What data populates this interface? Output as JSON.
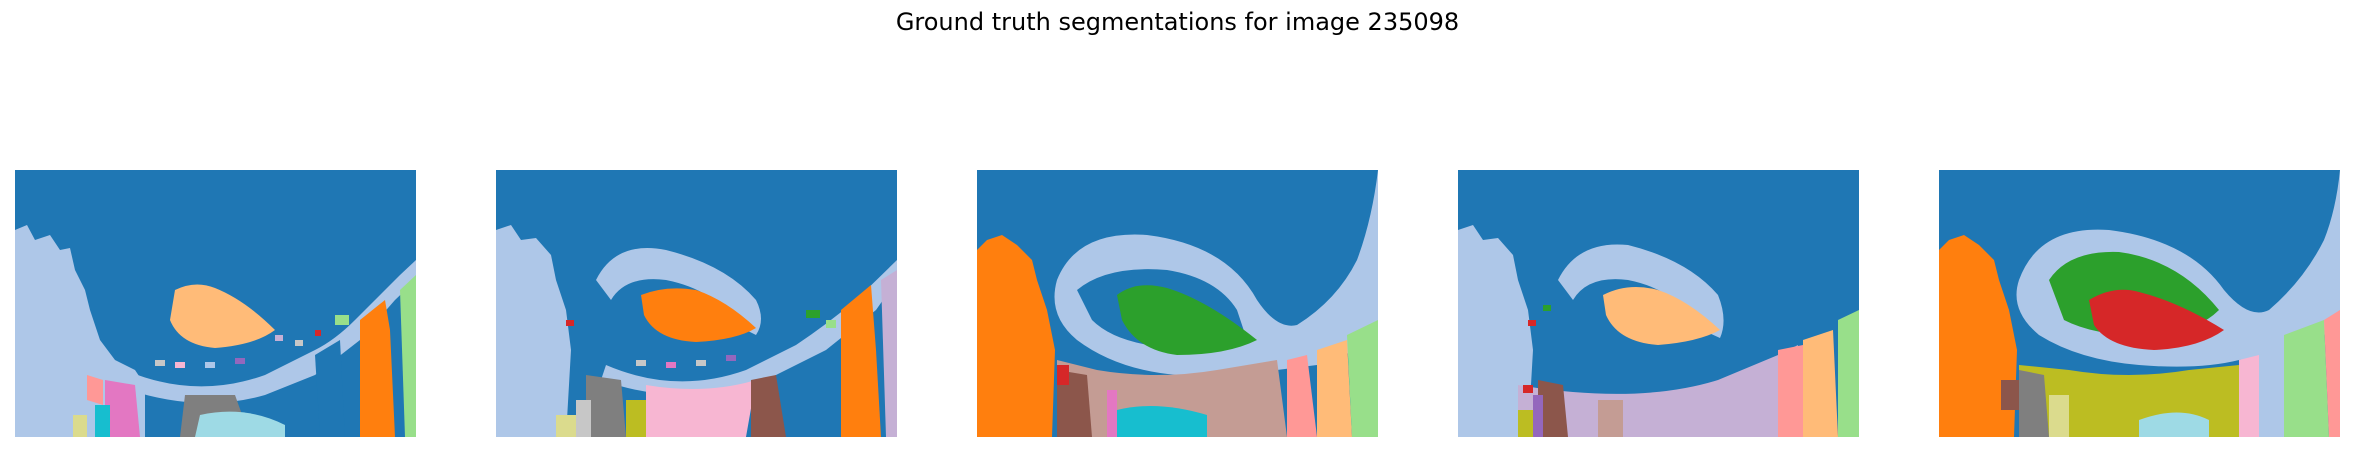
{
  "figure": {
    "title": "Ground truth segmentations for image 235098"
  },
  "panels": [
    {
      "name": "segmentation-1",
      "axis": "off"
    },
    {
      "name": "segmentation-2",
      "axis": "off"
    },
    {
      "name": "segmentation-3",
      "axis": "off"
    },
    {
      "name": "segmentation-4",
      "axis": "off"
    },
    {
      "name": "segmentation-5",
      "axis": "off"
    }
  ],
  "colors": {
    "blue": "#1f77b4",
    "light_blue": "#aec7e8",
    "orange": "#ff7f0e",
    "light_orange": "#ffbb78",
    "green": "#2ca02c",
    "light_green": "#98df8a",
    "red": "#d62728",
    "pink": "#e377c2",
    "light_pink": "#f7b6d2",
    "brown": "#8c564b",
    "rose_brown": "#c49c94",
    "gray": "#7f7f7f",
    "light_gray": "#c7c7c7",
    "olive": "#bcbd22",
    "light_olive": "#dbdb8d",
    "cyan": "#17becf",
    "light_cyan": "#9edae5",
    "lavender": "#c5b0d5",
    "purple": "#9467bd",
    "salmon": "#ff9896"
  }
}
